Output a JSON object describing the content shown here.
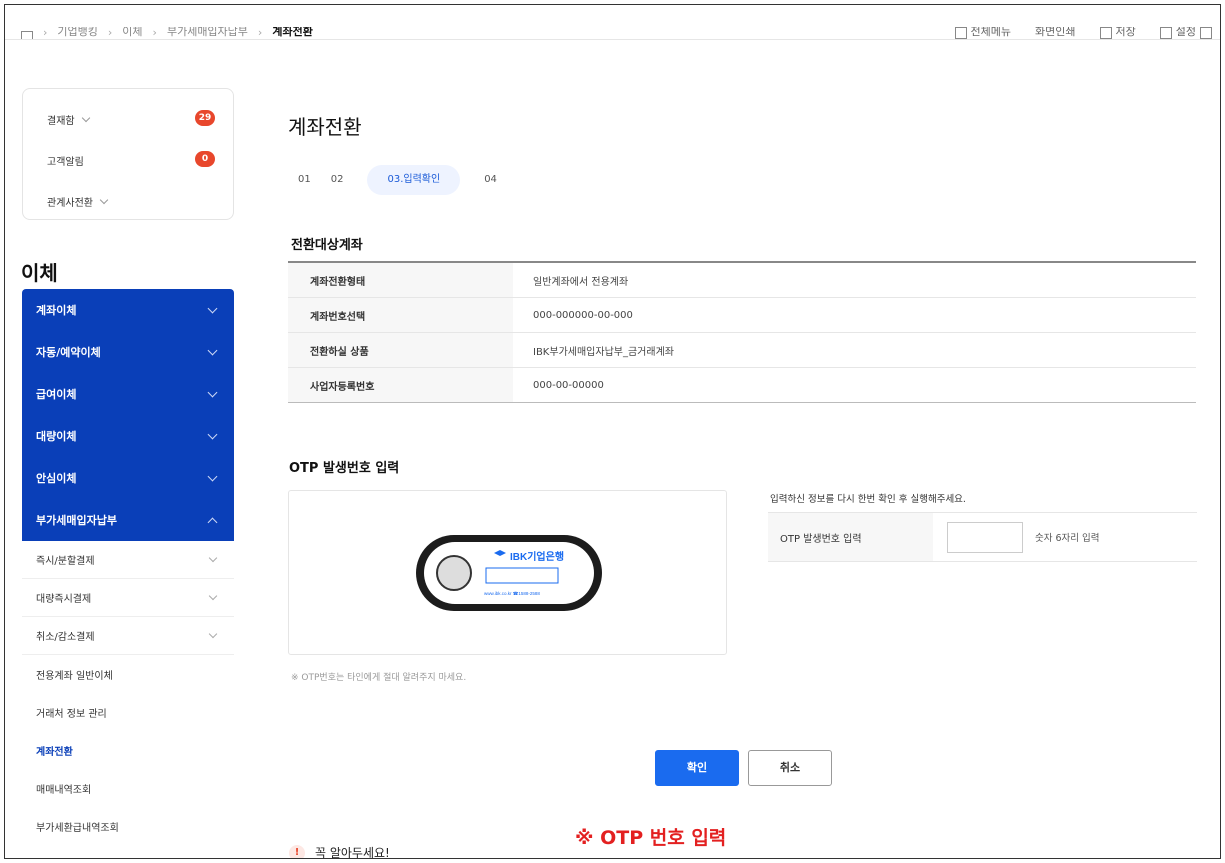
{
  "breadcrumb": {
    "items": [
      "기업뱅킹",
      "이체",
      "부가세매입자납부"
    ],
    "current": "계좌전환"
  },
  "utilities": [
    "전체메뉴",
    "화면인쇄",
    "저장",
    "설정"
  ],
  "summary": {
    "approval_label": "결재함",
    "approval_count": "29",
    "customer_alert_label": "고객알림",
    "customer_alert_count": "0",
    "affiliate_label": "관계사전환"
  },
  "sidebar": {
    "title": "이체",
    "main_items": [
      {
        "label": "계좌이체"
      },
      {
        "label": "자동/예약이체"
      },
      {
        "label": "급여이체"
      },
      {
        "label": "대량이체"
      },
      {
        "label": "안심이체"
      },
      {
        "label": "부가세매입자납부"
      }
    ],
    "sub_items": [
      {
        "label": "즉시/분할결제"
      },
      {
        "label": "대량즉시결제"
      },
      {
        "label": "취소/감소결제"
      },
      {
        "label": "전용계좌 일반이체"
      },
      {
        "label": "거래처 정보 관리"
      },
      {
        "label": "계좌전환"
      },
      {
        "label": "매매내역조회"
      },
      {
        "label": "부가세환급내역조회"
      }
    ]
  },
  "main": {
    "title": "계좌전환",
    "steps": [
      "01",
      "02",
      "03.입력확인",
      "04"
    ],
    "section_title": "전환대상계좌",
    "rows": [
      {
        "key": "계좌전환형태",
        "value": "일반계좌에서 전용계좌"
      },
      {
        "key": "계좌번호선택",
        "value": "000-000000-00-000"
      },
      {
        "key": "전환하실 상품",
        "value": "IBK부가세매입자납부_금거래계좌"
      },
      {
        "key": "사업자등록번호",
        "value": "000-00-00000"
      }
    ]
  },
  "otp": {
    "title": "OTP 발생번호 입력",
    "device_brand": "IBK기업은행",
    "device_footer": "www.ibk.co.kr ☎1588-2588",
    "note": "※ OTP번호는 타인에게 절대 알려주지 마세요.",
    "guide": "입력하신 정보를 다시 한번 확인 후 실행해주세요.",
    "field_label": "OTP 발생번호 입력",
    "input_value": "",
    "input_hint": "숫자 6자리 입력"
  },
  "buttons": {
    "confirm": "확인",
    "cancel": "취소"
  },
  "annotation": "※ OTP 번호 입력",
  "notice": {
    "icon": "!",
    "label": "꼭 알아두세요!"
  }
}
